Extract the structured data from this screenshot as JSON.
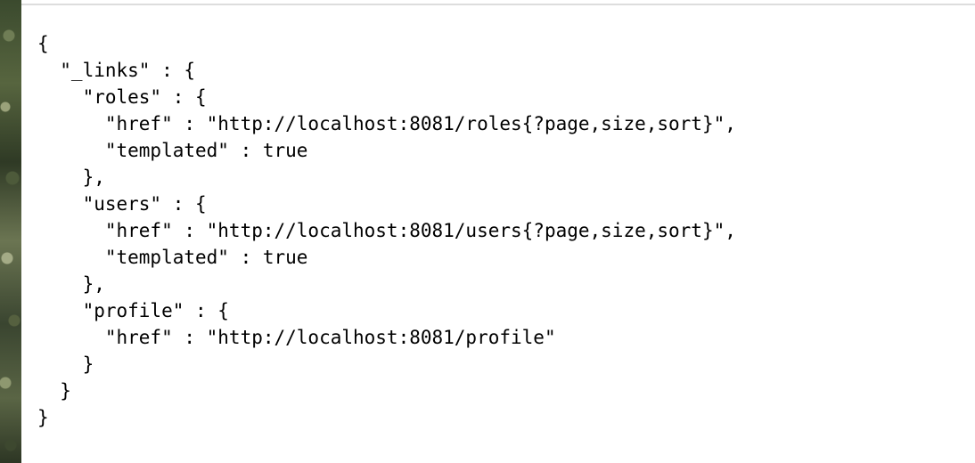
{
  "json_lines": [
    "{",
    "  \"_links\" : {",
    "    \"roles\" : {",
    "      \"href\" : \"http://localhost:8081/roles{?page,size,sort}\",",
    "      \"templated\" : true",
    "    },",
    "    \"users\" : {",
    "      \"href\" : \"http://localhost:8081/users{?page,size,sort}\",",
    "      \"templated\" : true",
    "    },",
    "    \"profile\" : {",
    "      \"href\" : \"http://localhost:8081/profile\"",
    "    }",
    "  }",
    "}"
  ]
}
